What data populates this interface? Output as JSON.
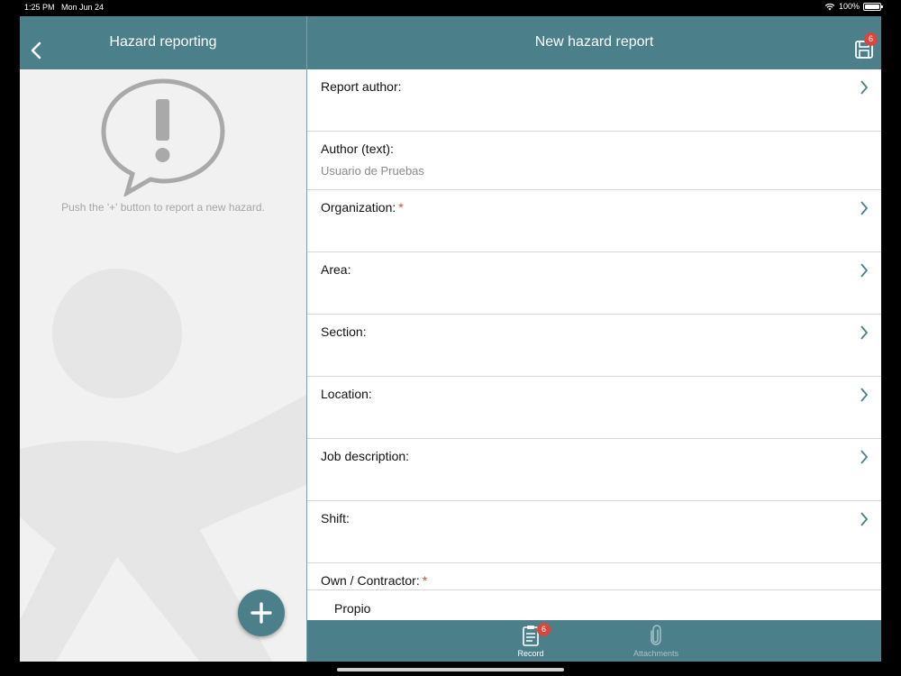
{
  "status_bar": {
    "time": "1:25 PM",
    "date": "Mon Jun 24",
    "battery": "100%"
  },
  "left_panel": {
    "title": "Hazard reporting",
    "empty_message": "Push the '+' button to report a new hazard."
  },
  "header": {
    "title": "New hazard report",
    "save_badge": "6"
  },
  "form": {
    "report_author_label": "Report author:",
    "author_text_label": "Author (text):",
    "author_text_value": "Usuario de Pruebas",
    "organization_label": "Organization:",
    "area_label": "Area:",
    "section_label": "Section:",
    "location_label": "Location:",
    "job_description_label": "Job description:",
    "shift_label": "Shift:",
    "own_contractor_label": "Own / Contractor:",
    "own_contractor_value": "Propio",
    "required_mark": "*"
  },
  "tabbar": {
    "record_label": "Record",
    "record_badge": "6",
    "attachments_label": "Attachments"
  },
  "colors": {
    "accent": "#4b7f8a",
    "required": "#e0453d",
    "badge": "#d9463e"
  }
}
